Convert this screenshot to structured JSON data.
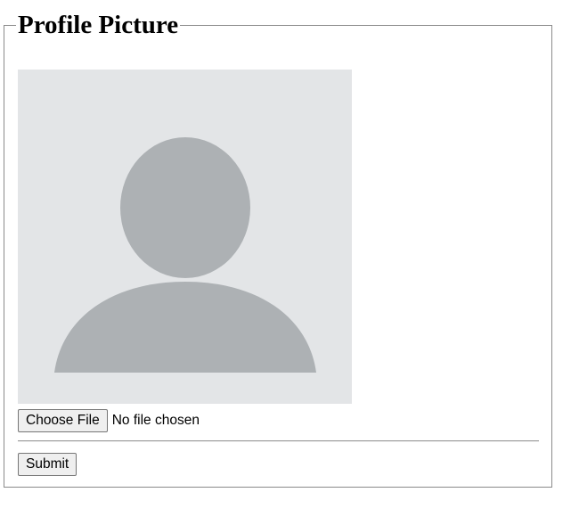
{
  "form": {
    "legend": "Profile Picture",
    "avatar": {
      "icon": "user-silhouette-icon",
      "background": "#e3e5e7",
      "silhouette_color": "#adb1b4"
    },
    "file_input": {
      "button_label": "Choose File",
      "status": "No file chosen"
    },
    "submit_label": "Submit"
  }
}
